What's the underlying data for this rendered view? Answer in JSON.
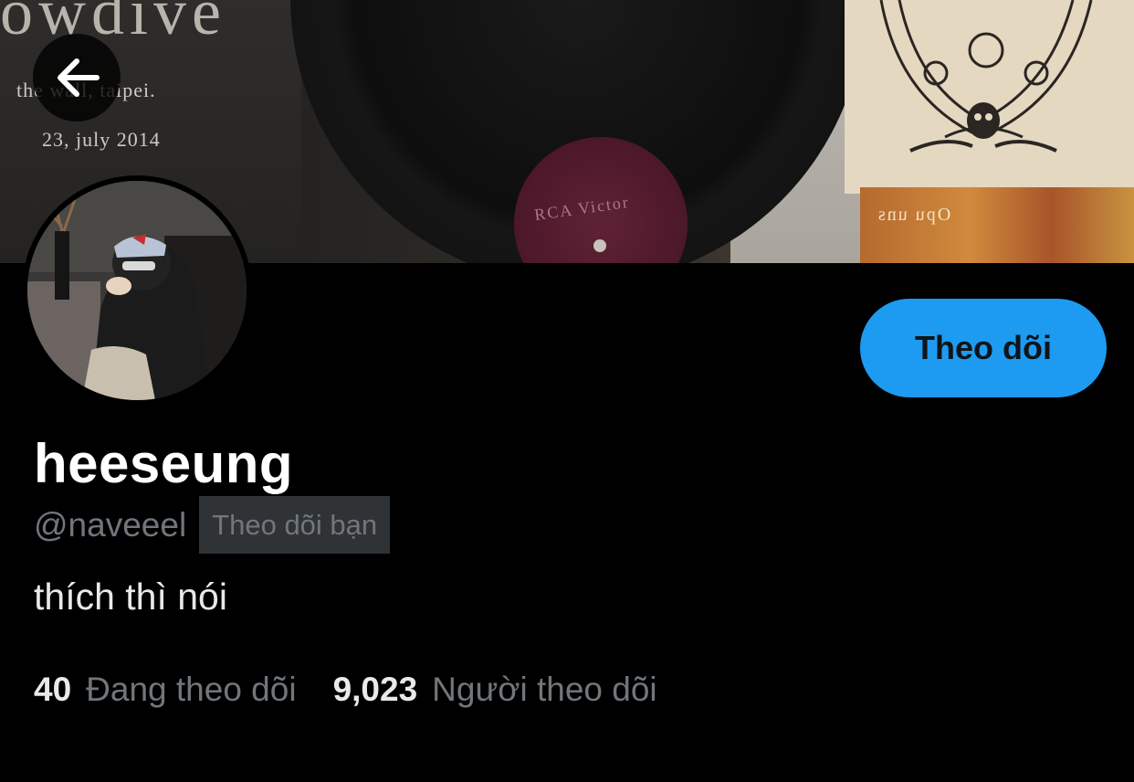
{
  "banner": {
    "poster_title": "owdive",
    "poster_line1": "the wall, taipei.",
    "poster_line2": "23, july 2014",
    "record_label": "RCA Victor",
    "card_text": "Opu uns"
  },
  "back_button": {
    "icon": "arrow-left-icon"
  },
  "profile": {
    "display_name": "heeseung",
    "handle": "@naveeel",
    "follows_you_badge": "Theo dõi bạn",
    "bio": "thích thì nói",
    "follow_button_label": "Theo dõi",
    "following_count": "40",
    "following_label": "Đang theo dõi",
    "followers_count": "9,023",
    "followers_label": "Người theo dõi"
  },
  "colors": {
    "accent": "#1d9bf0",
    "background": "#000000",
    "text_primary": "#e7e9ea",
    "text_secondary": "#71767b",
    "badge_bg": "#2f3336"
  }
}
